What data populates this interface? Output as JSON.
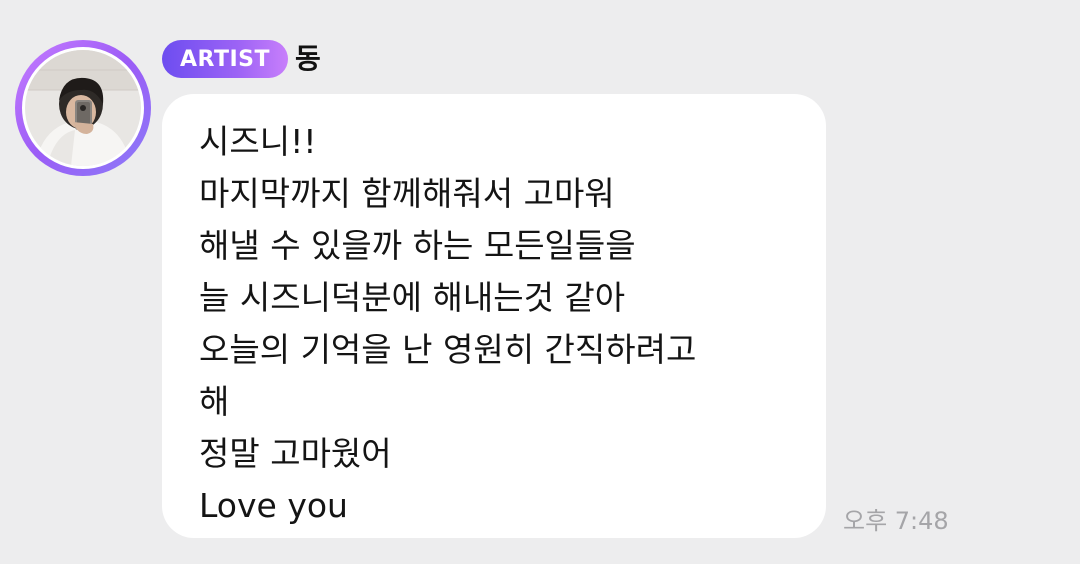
{
  "sender": {
    "badge": "ARTIST",
    "name": "동",
    "avatar_icon": "profile-photo-mirror-selfie",
    "badge_colors": [
      "#6d4df0",
      "#c87ffb"
    ]
  },
  "message": {
    "lines": [
      "시즈니!!",
      "마지막까지 함께해줘서 고마워",
      "해낼 수 있을까 하는 모든일들을",
      "늘 시즈니덕분에 해내는것 같아",
      "오늘의 기억을 난 영원히 간직하려고",
      "해",
      "정말 고마웠어",
      "Love you"
    ],
    "timestamp": "오후 7:48"
  }
}
